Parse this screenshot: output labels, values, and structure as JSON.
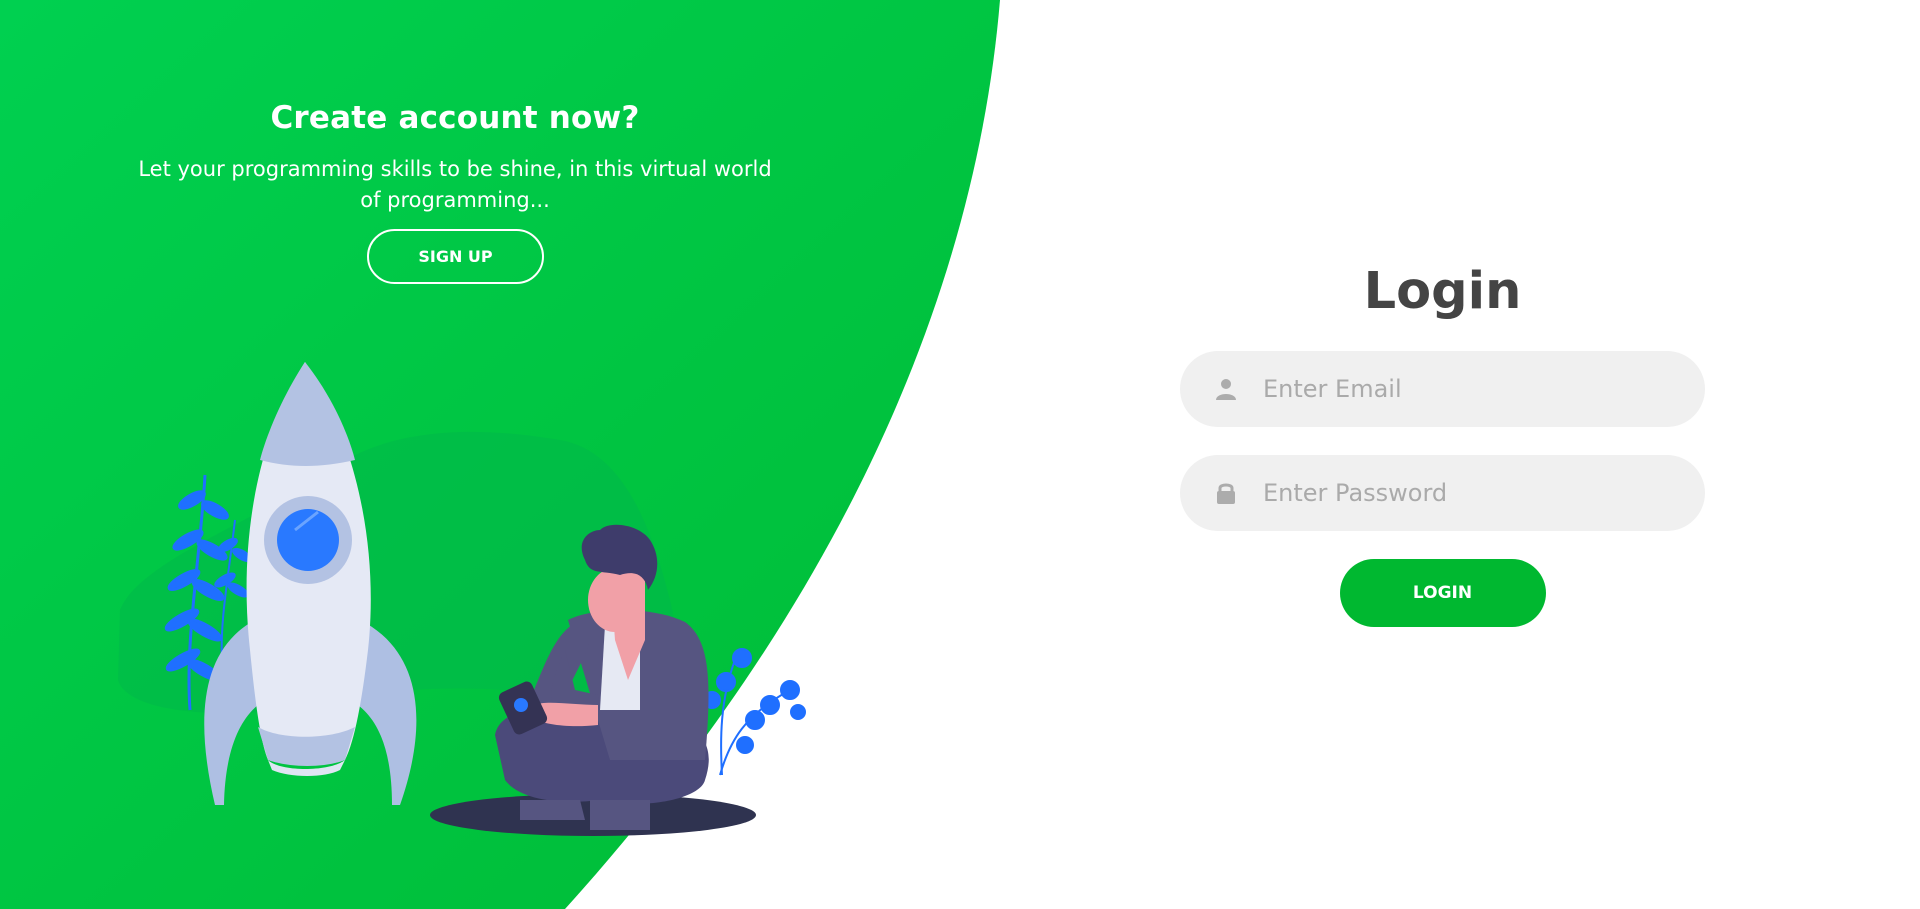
{
  "left_panel": {
    "title": "Create account now?",
    "text": "Let your programming skills to be shine, in this virtual world of programming...",
    "signup_label": "SIGN UP"
  },
  "login_form": {
    "title": "Login",
    "email_placeholder": "Enter Email",
    "password_placeholder": "Enter Password",
    "login_label": "LOGIN"
  },
  "colors": {
    "brand_green": "#00c741",
    "login_button": "#00b830",
    "input_bg": "#f0f0f0",
    "title_text": "#444444",
    "rocket_window": "#2979ff",
    "plant_leaves": "#1f6fff"
  },
  "icons": {
    "email": "user-icon",
    "password": "lock-icon"
  }
}
